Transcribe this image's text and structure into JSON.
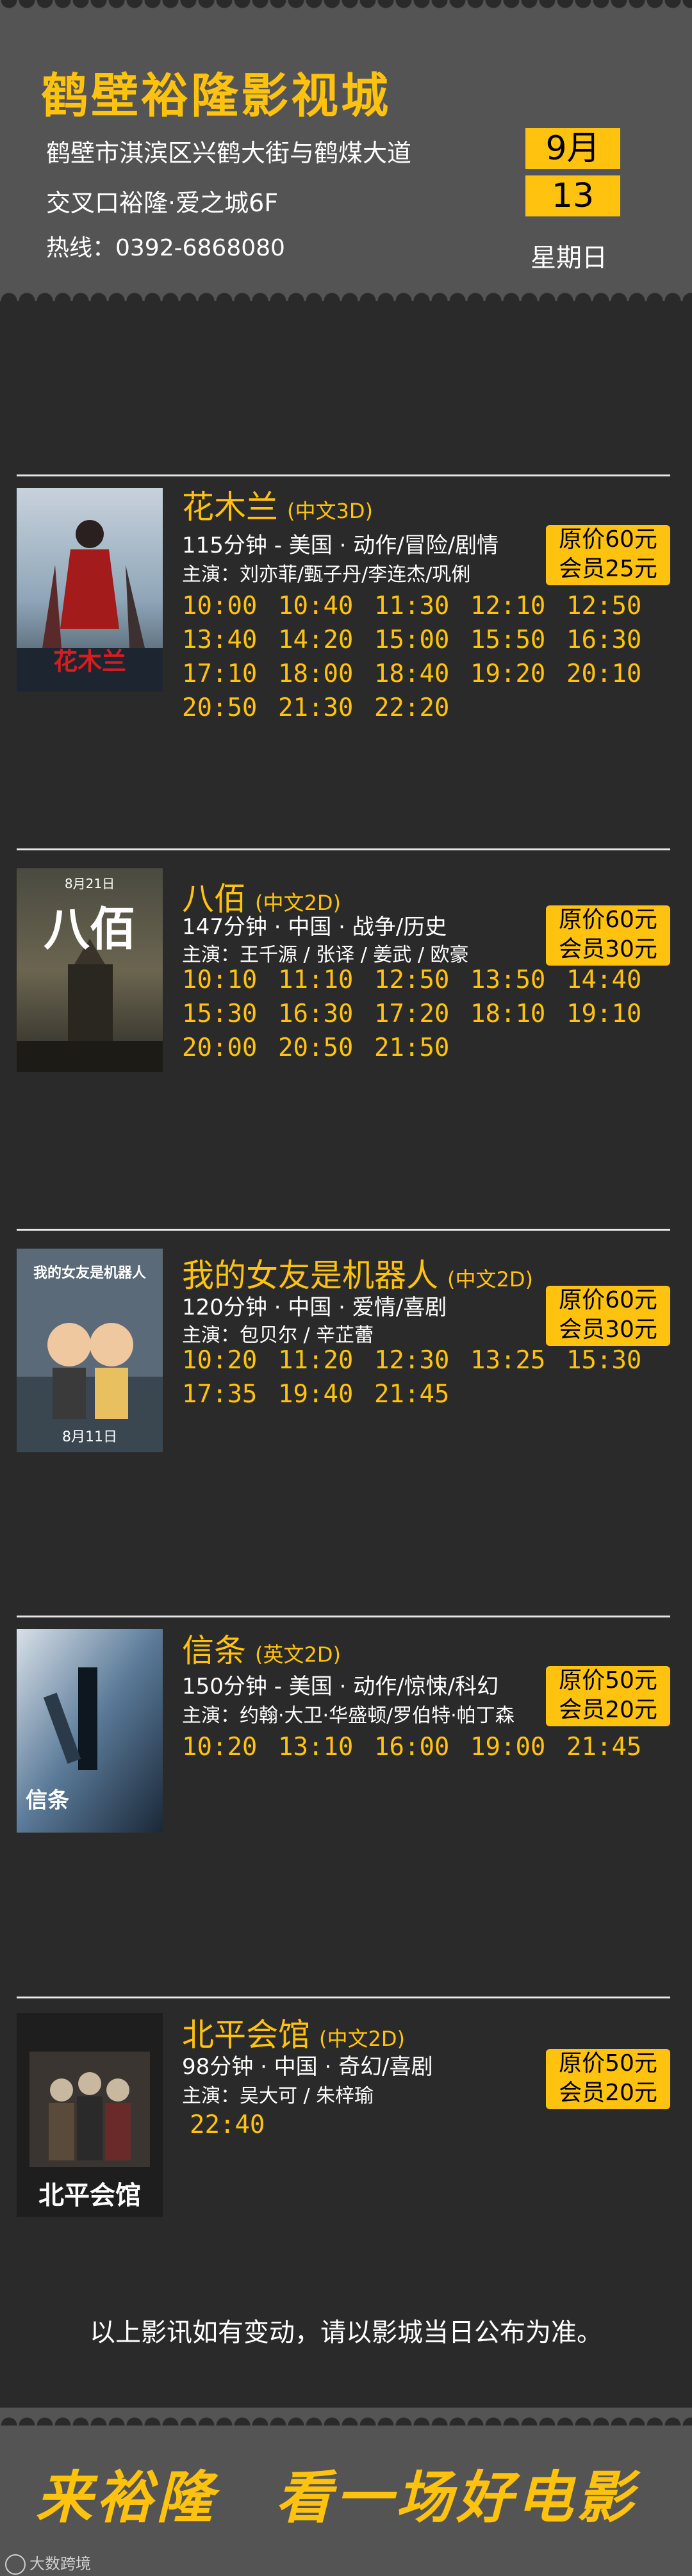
{
  "header": {
    "title": "鹤壁裕隆影视城",
    "address_line1": "鹤壁市淇滨区兴鹤大街与鹤煤大道",
    "address_line2": "交叉口裕隆·爱之城6F",
    "hotline": "热线：0392-6868080",
    "month": "9月",
    "day": "13",
    "weekday": "星期日"
  },
  "movies": [
    {
      "title": "花木兰",
      "format": "(中文3D)",
      "info": "115分钟 - 美国 · 动作/冒险/剧情",
      "cast": "主演：刘亦菲/甄子丹/李连杰/巩俐",
      "price_original": "原价60元",
      "price_member": "会员25元",
      "poster_caption": "花木兰",
      "times": [
        "10:00",
        "10:40",
        "11:30",
        "12:10",
        "12:50",
        "13:40",
        "14:20",
        "15:00",
        "15:50",
        "16:30",
        "17:10",
        "18:00",
        "18:40",
        "19:20",
        "20:10",
        "20:50",
        "21:30",
        "22:20"
      ]
    },
    {
      "title": "八佰",
      "format": "(中文2D)",
      "info": "147分钟 · 中国 · 战争/历史",
      "cast": "主演：王千源 / 张译 / 姜武 / 欧豪",
      "price_original": "原价60元",
      "price_member": "会员30元",
      "poster_caption": "八佰",
      "poster_date": "8月21日",
      "times": [
        "10:10",
        "11:10",
        "12:50",
        "13:50",
        "14:40",
        "15:30",
        "16:30",
        "17:20",
        "18:10",
        "19:10",
        "20:00",
        "20:50",
        "21:50"
      ]
    },
    {
      "title": "我的女友是机器人",
      "format": "(中文2D)",
      "info": "120分钟 · 中国 · 爱情/喜剧",
      "cast": "主演：包贝尔 / 辛芷蕾",
      "price_original": "原价60元",
      "price_member": "会员30元",
      "poster_caption": "我的女友是机器人",
      "poster_date": "8月11日",
      "times": [
        "10:20",
        "11:20",
        "12:30",
        "13:25",
        "15:30",
        "17:35",
        "19:40",
        "21:45"
      ]
    },
    {
      "title": "信条",
      "format": "(英文2D)",
      "info": "150分钟 - 美国 · 动作/惊悚/科幻",
      "cast": "主演：约翰·大卫·华盛顿/罗伯特·帕丁森",
      "price_original": "原价50元",
      "price_member": "会员20元",
      "poster_caption": "信条",
      "times": [
        "10:20",
        "13:10",
        "16:00",
        "19:00",
        "21:45"
      ]
    },
    {
      "title": "北平会馆",
      "format": "(中文2D)",
      "info": "98分钟 · 中国 · 奇幻/喜剧",
      "cast": "主演：吴大可 / 朱梓瑜",
      "price_original": "原价50元",
      "price_member": "会员20元",
      "poster_caption": "北平会馆",
      "times": [
        "22:40"
      ]
    }
  ],
  "footer": {
    "note": "以上影讯如有变动，请以影城当日公布为准。",
    "slogan_left": "来裕隆",
    "slogan_right": "看一场好电影",
    "watermark": "大数跨境"
  },
  "colors": {
    "accent": "#ffc20e",
    "background": "#2a2a2a",
    "band": "#545454"
  }
}
